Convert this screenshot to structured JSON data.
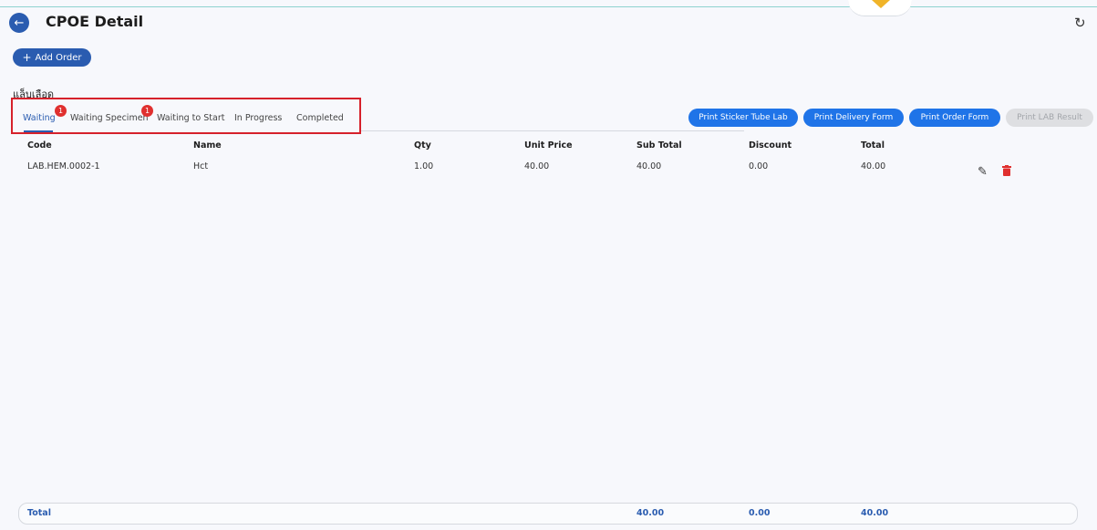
{
  "header": {
    "back_icon": "arrow-left-icon",
    "title": "CPOE Detail",
    "refresh_icon": "refresh-icon"
  },
  "toolbar": {
    "add_order_label": "Add Order"
  },
  "section": {
    "label": "แล็บเลือด"
  },
  "tabs": [
    {
      "label": "Waiting",
      "active": true,
      "badge": "1"
    },
    {
      "label": "Waiting Specimen",
      "active": false,
      "badge": "1"
    },
    {
      "label": "Waiting to Start",
      "active": false
    },
    {
      "label": "In Progress",
      "active": false
    },
    {
      "label": "Completed",
      "active": false
    }
  ],
  "actions": [
    {
      "label": "Print Sticker Tube Lab",
      "enabled": true
    },
    {
      "label": "Print Delivery Form",
      "enabled": true
    },
    {
      "label": "Print Order Form",
      "enabled": true
    },
    {
      "label": "Print LAB Result",
      "enabled": false
    }
  ],
  "table": {
    "columns": [
      "Code",
      "Name",
      "Qty",
      "Unit Price",
      "Sub Total",
      "Discount",
      "Total"
    ],
    "rows": [
      {
        "code": "LAB.HEM.0002-1",
        "name": "Hct",
        "qty": "1.00",
        "unit_price": "40.00",
        "sub_total": "40.00",
        "discount": "0.00",
        "total": "40.00"
      }
    ]
  },
  "footer": {
    "label": "Total",
    "sub_total": "40.00",
    "discount": "0.00",
    "total": "40.00"
  },
  "colors": {
    "primary": "#2a5cb0",
    "button": "#1f74e8",
    "badge": "#e0302f",
    "highlight_box": "#d6212b"
  }
}
